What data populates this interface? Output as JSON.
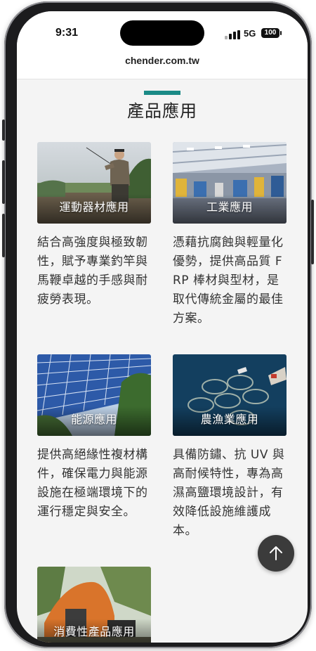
{
  "status_bar": {
    "time": "9:31",
    "network": "5G",
    "battery": "100"
  },
  "browser": {
    "url": "chender.com.tw"
  },
  "section": {
    "title": "產品應用",
    "accent_color": "#1a8a86"
  },
  "cards": [
    {
      "label": "運動器材應用",
      "image": "angler-fishing-photo",
      "description": "結合高強度與極致韌性，賦予專業釣竿與馬鞭卓越的手感與耐疲勞表現。"
    },
    {
      "label": "工業應用",
      "image": "factory-interior-photo",
      "description": "憑藉抗腐蝕與輕量化優勢，提供高品質 FRP 棒材與型材，是取代傳統金屬的最佳方案。"
    },
    {
      "label": "能源應用",
      "image": "solar-panels-photo",
      "description": "提供高絕緣性複材構件，確保電力與能源設施在極端環境下的運行穩定與安全。"
    },
    {
      "label": "農漁業應用",
      "image": "fish-farm-aerial-photo",
      "description": "具備防鏽、抗 UV 與高耐候特性，專為高濕高鹽環境設計，有效降低設施維護成本。"
    },
    {
      "label": "消費性產品應用",
      "image": "camping-tent-photo",
      "description": ""
    }
  ],
  "back_to_top": {
    "icon": "arrow-up-icon"
  }
}
